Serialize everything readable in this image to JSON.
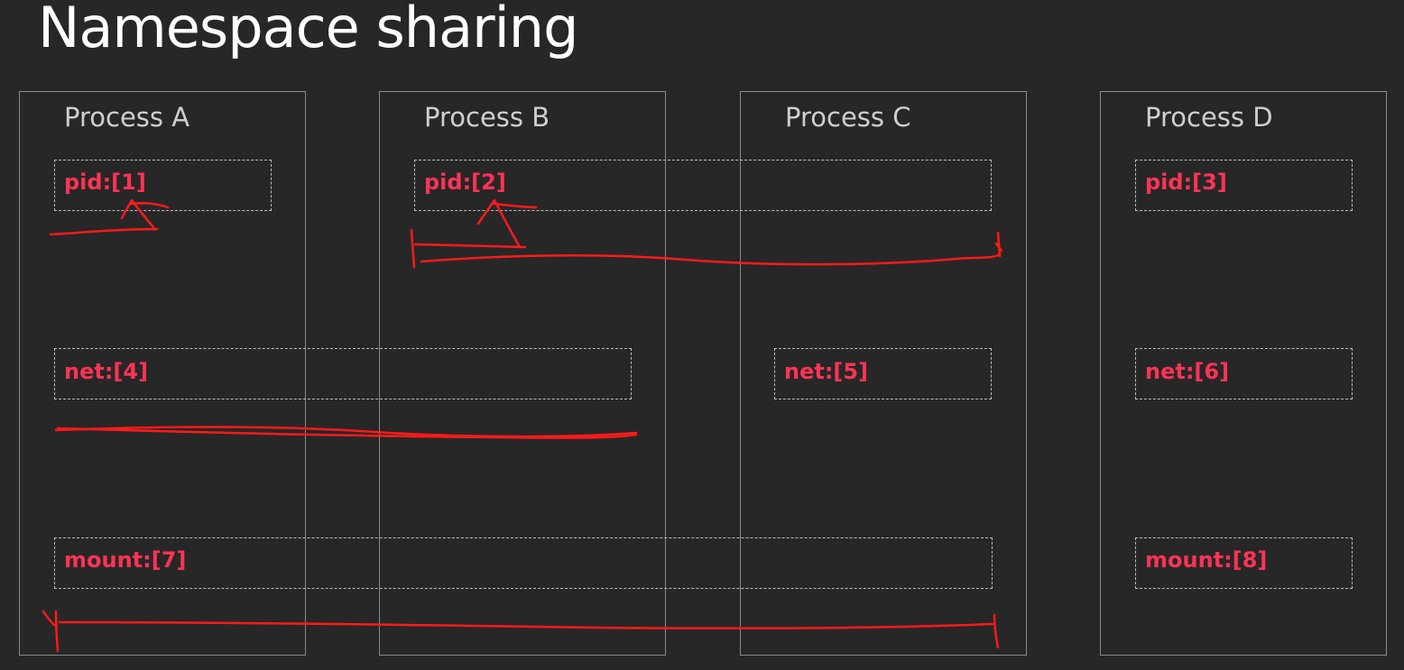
{
  "title": "Namespace sharing",
  "processes": [
    {
      "label": "Process A"
    },
    {
      "label": "Process B"
    },
    {
      "label": "Process C"
    },
    {
      "label": "Process D"
    }
  ],
  "namespaces": [
    {
      "label": "pid:[1]"
    },
    {
      "label": "pid:[2]"
    },
    {
      "label": "pid:[3]"
    },
    {
      "label": "net:[4]"
    },
    {
      "label": "net:[5]"
    },
    {
      "label": "net:[6]"
    },
    {
      "label": "mount:[7]"
    },
    {
      "label": "mount:[8]"
    }
  ],
  "colors": {
    "background": "#272727",
    "title": "#ffffff",
    "process_border": "#8a8a8a",
    "process_label": "#cfcfcf",
    "namespace_label": "#ff3355",
    "namespace_border": "#bdbdbd",
    "annotation": "#ff1a1a"
  }
}
